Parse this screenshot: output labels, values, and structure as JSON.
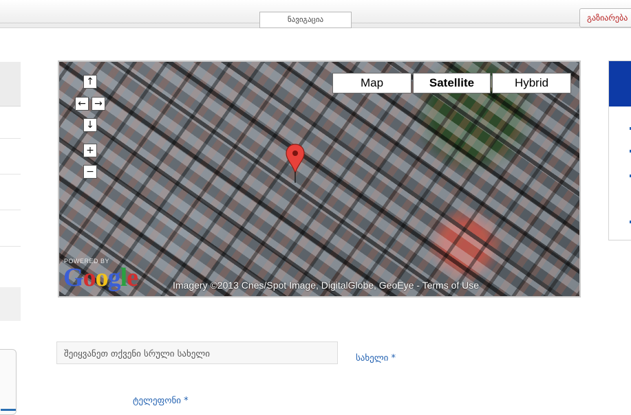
{
  "top_bar": {
    "navigation_tab": "ნავიგაცია",
    "action_button": "გაზიარება"
  },
  "map": {
    "type_buttons": {
      "map": "Map",
      "satellite": "Satellite",
      "hybrid": "Hybrid"
    },
    "selected_type": "Satellite",
    "controls": {
      "pan_up": "↑",
      "pan_left": "←",
      "pan_right": "→",
      "pan_down": "↓",
      "zoom_in": "+",
      "zoom_out": "−"
    },
    "powered_by": "POWERED BY",
    "logo": {
      "G": "G",
      "o1": "o",
      "o2": "o",
      "g": "g",
      "l": "l",
      "e": "e"
    },
    "attribution": "Imagery ©2013 Cnes/Spot Image, DigitalGlobe, GeoEye - Terms of Use",
    "marker_color": "#e8413a"
  },
  "form": {
    "name_placeholder": "შეიყვანეთ თქვენი სრული სახელი",
    "name_label": "სახელი *",
    "phone_label": "ტელეფონი *"
  },
  "colors": {
    "accent_link": "#1f5fb0",
    "header_blue": "#0d3aa6",
    "button_text": "#b81f1f"
  }
}
